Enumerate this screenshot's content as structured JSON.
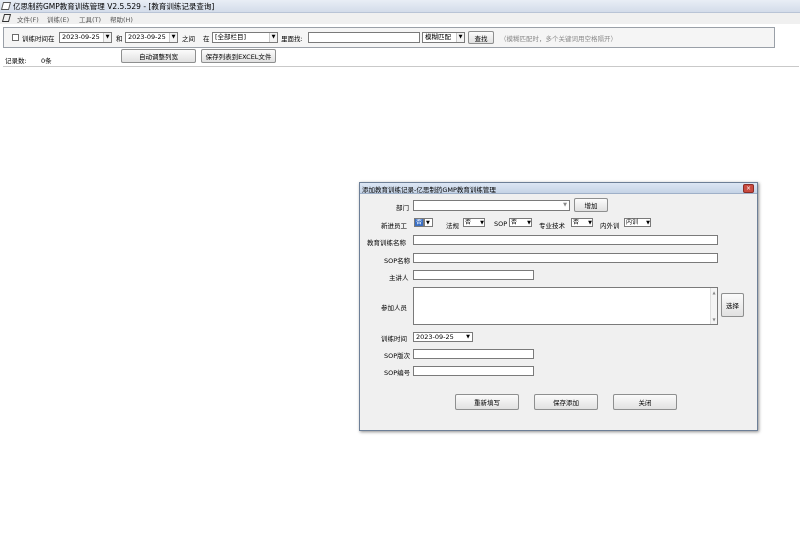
{
  "window": {
    "title": "亿思制药GMP教育训练管理 V2.5.529 - [教育训练记录查询]"
  },
  "menu": [
    "文件(F)",
    "训练(E)",
    "工具(T)",
    "帮助(H)"
  ],
  "filter": {
    "time_checkbox_label": "训练时间在",
    "date_from": "2023-09-25",
    "and_label": "和",
    "date_to": "2023-09-25",
    "between_label": "之间",
    "in_label": "在",
    "field_select": "[全部栏目]",
    "search_label": "里面找:",
    "search_value": "",
    "match_select": "模糊匹配",
    "search_button": "查找",
    "hint": "（模糊匹配时，多个关键词用空格隔开）"
  },
  "records": {
    "count_label": "记录数:",
    "count_value": "0条",
    "auto_width_button": "自动调整列宽",
    "export_button": "保存列表到EXCEL文件"
  },
  "dialog": {
    "title": "添加教育训练记录-亿思制药GMP教育训练管理",
    "close_icon": "×",
    "dept_label": "部门",
    "dept_value": "",
    "add_button": "增加",
    "new_employee_label": "新进员工",
    "new_employee_value": "否",
    "regulation_label": "法规",
    "regulation_value": "否",
    "sop_label": "SOP",
    "sop_value": "否",
    "tech_label": "专业技术",
    "tech_value": "否",
    "inout_label": "内外训",
    "inout_value": "内训",
    "training_name_label": "教育训练名称",
    "training_name_value": "",
    "sop_name_label": "SOP名称",
    "sop_name_value": "",
    "lecturer_label": "主讲人",
    "lecturer_value": "",
    "participants_label": "参加人员",
    "participants_value": "",
    "select_button": "选择",
    "training_time_label": "训练时间",
    "training_time_value": "2023-09-25",
    "sop_version_label": "SOP版次",
    "sop_version_value": "",
    "sop_number_label": "SOP编号",
    "sop_number_value": "",
    "reset_button": "重新填写",
    "save_button": "保存添加",
    "close_button": "关闭"
  },
  "colors": {
    "titlebar": "#d3dcea",
    "dialog_bg": "#f0f0f0",
    "close_red": "#c94a3f",
    "selected_blue": "#3a6fc4"
  }
}
